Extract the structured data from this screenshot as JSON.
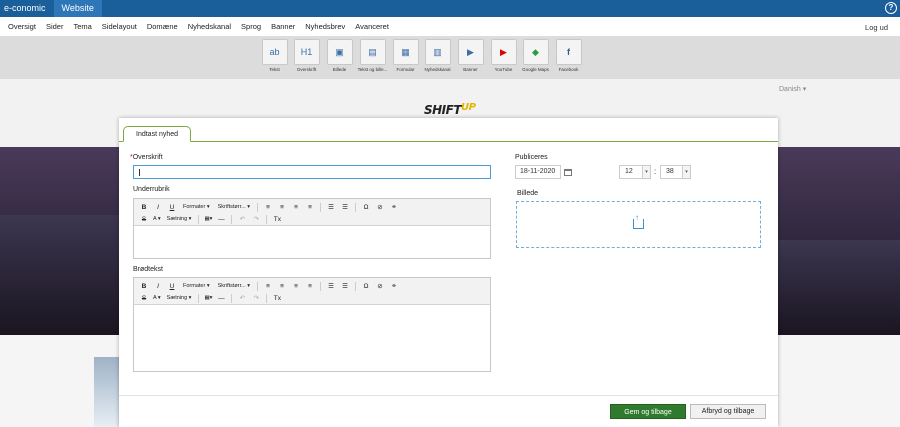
{
  "topbar": {
    "brand": "e-conomic",
    "active_tab": "Website",
    "help": "?"
  },
  "menu": {
    "items": [
      "Oversigt",
      "Sider",
      "Tema",
      "Sidelayout",
      "Domæne",
      "Nyhedskanal",
      "Sprog",
      "Banner",
      "Nyhedsbrev",
      "Avanceret"
    ],
    "logout": "Log ud"
  },
  "tools": [
    {
      "label": "Tekst",
      "glyph": "ab",
      "icon": "text-icon"
    },
    {
      "label": "Overskrift",
      "glyph": "H1",
      "icon": "heading-icon"
    },
    {
      "label": "Billede",
      "glyph": "▣",
      "icon": "image-icon"
    },
    {
      "label": "Tekst og bille...",
      "glyph": "▤",
      "icon": "text-image-icon"
    },
    {
      "label": "Formular",
      "glyph": "▦",
      "icon": "form-icon"
    },
    {
      "label": "Nyhedskanal",
      "glyph": "▥",
      "icon": "newsfeed-icon"
    },
    {
      "label": "Banner",
      "glyph": "▶",
      "icon": "banner-icon"
    },
    {
      "label": "YouTube",
      "glyph": "▶",
      "icon": "youtube-icon"
    },
    {
      "label": "Google Maps",
      "glyph": "◆",
      "icon": "google-maps-icon"
    },
    {
      "label": "Facebook",
      "glyph": "f",
      "icon": "facebook-icon"
    }
  ],
  "preview": {
    "language": "Danish ▾",
    "logo_main": "SHIFT",
    "logo_accent": "UP"
  },
  "modal": {
    "tab": "Indtast nyhed",
    "headline_label": "Overskrift",
    "headline_value": "",
    "subheading_label": "Underrubrik",
    "body_label": "Brødtekst",
    "publish_label": "Publiceres",
    "publish_date": "18-11-2020",
    "hour": "12",
    "minute": "38",
    "time_sep": ":",
    "image_label": "Billede",
    "toolbar": {
      "bold": "B",
      "italic": "I",
      "underline": "U",
      "formats": "Formater ▾",
      "font_size": "Skriftstørr... ▾",
      "strike": "S",
      "color": "A ▾",
      "typeface": "Sætning ▾",
      "table": "▦▾",
      "hr": "—",
      "undo": "↶",
      "redo": "↷",
      "clear": "Tx",
      "omega": "Ω"
    },
    "save_button": "Gem og tilbage",
    "cancel_button": "Afbryd og tilbage"
  }
}
